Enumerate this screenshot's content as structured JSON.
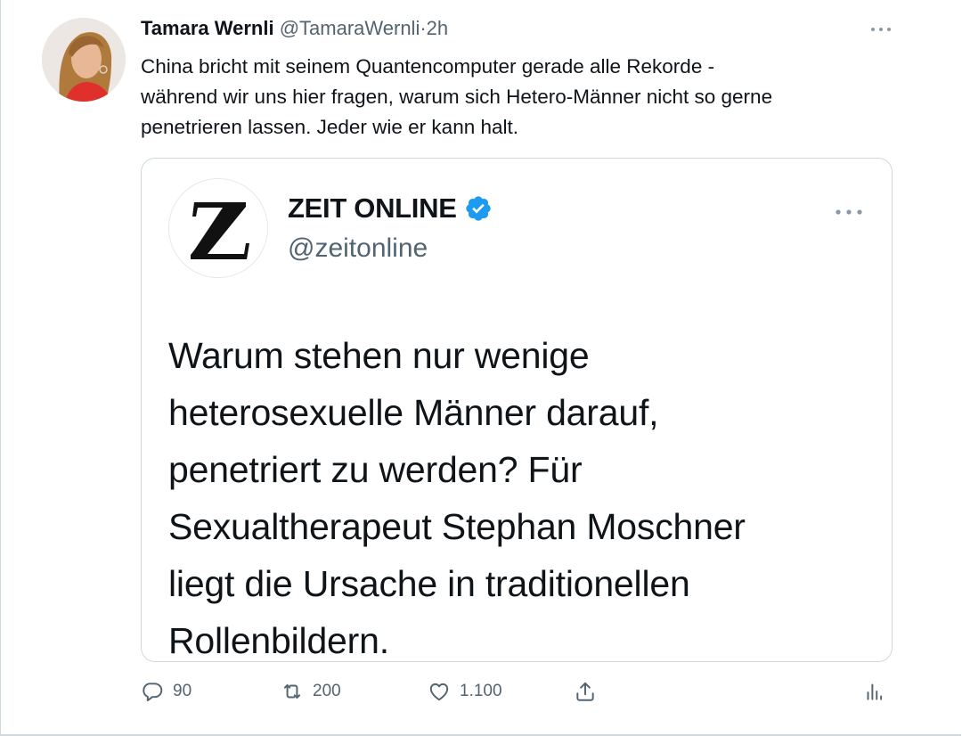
{
  "tweet": {
    "author_name": "Tamara Wernli",
    "author_handle": "@TamaraWernli",
    "separator": "·",
    "time": "2h",
    "text_lines": [
      "China bricht mit seinem Quantencomputer gerade alle Rekorde -",
      "während wir uns hier fragen, warum sich Hetero-Männer nicht so gerne",
      "penetrieren lassen. Jeder wie er kann halt."
    ],
    "more_icon": "more-horizontal-icon"
  },
  "quoted": {
    "avatar_letter": "Z",
    "name": "ZEIT ONLINE",
    "verified_icon": "verified-badge-icon",
    "verified_color": "#1d9bf0",
    "handle": "@zeitonline",
    "text_lines": [
      "Warum stehen nur wenige",
      "heterosexuelle Männer darauf,",
      "penetriert zu werden? Für",
      "Sexualtherapeut Stephan Moschner",
      "liegt die Ursache in traditionellen",
      "Rollenbildern."
    ]
  },
  "actions": {
    "reply": {
      "icon": "reply-icon",
      "count": "90"
    },
    "retweet": {
      "icon": "retweet-icon",
      "count": "200"
    },
    "like": {
      "icon": "heart-icon",
      "count": "1.100"
    },
    "share": {
      "icon": "share-icon"
    },
    "analytics": {
      "icon": "analytics-icon"
    }
  },
  "colors": {
    "text_primary": "#0f1419",
    "text_secondary": "#536471",
    "border": "#cfd9de",
    "verified_blue": "#1d9bf0"
  }
}
